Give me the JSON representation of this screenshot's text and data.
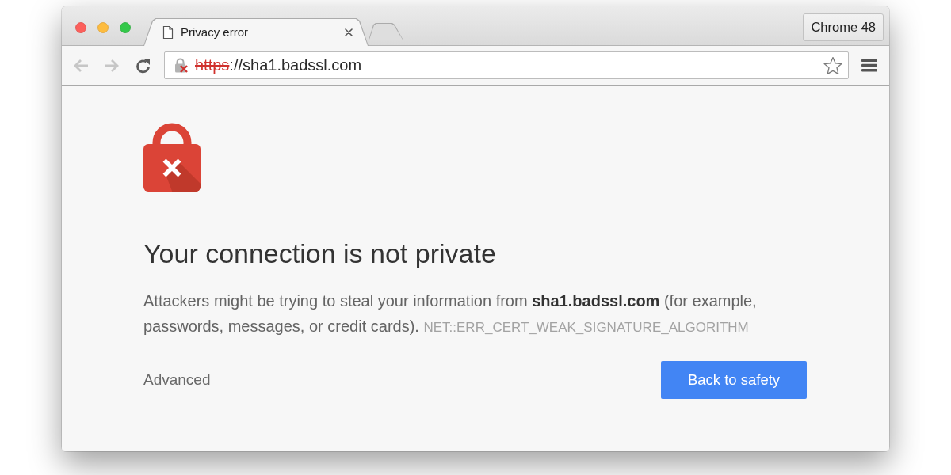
{
  "window": {
    "profile_button": "Chrome 48"
  },
  "tabs": [
    {
      "title": "Privacy error",
      "selected": true
    }
  ],
  "toolbar": {
    "nav_buttons": [
      {
        "kind": "back",
        "disabled": true
      },
      {
        "kind": "forward",
        "disabled": true
      },
      {
        "kind": "reload",
        "disabled": false
      }
    ],
    "address": {
      "scheme": "https",
      "rest": "://sha1.badssl.com",
      "certificate_error": true
    }
  },
  "page": {
    "heading": "Your connection is not private",
    "message": "Attackers might be trying to steal your information from **sha1.badssl.com** (for example, passwords, messages, or credit cards).",
    "error_code": "NET::ERR_CERT_WEAK_SIGNATURE_ALGORITHM",
    "advanced_link": "Advanced",
    "primary_button": "Back to safety"
  }
}
